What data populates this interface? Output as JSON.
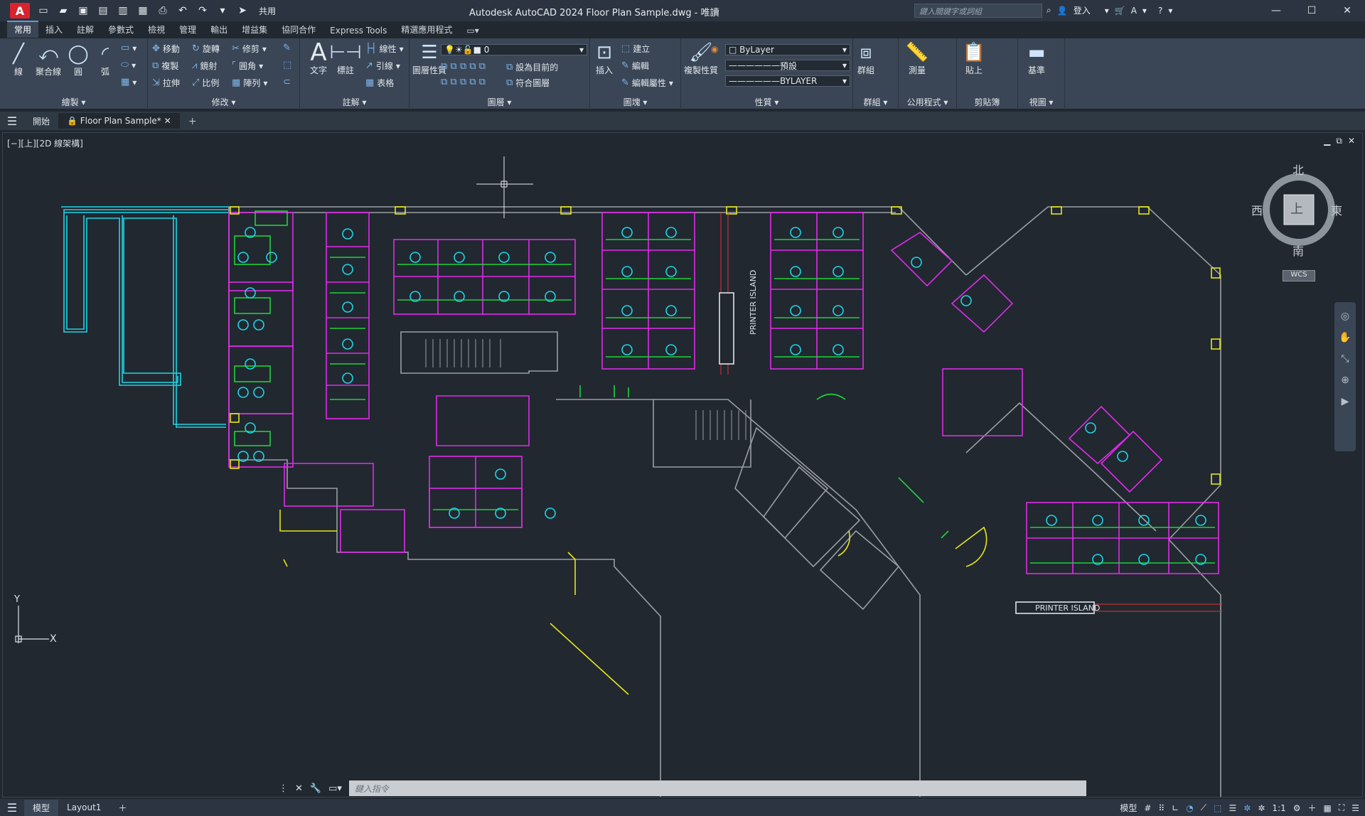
{
  "window": {
    "title": "Autodesk AutoCAD 2024    Floor Plan Sample.dwg - 唯讀",
    "search_placeholder": "鍵入關鍵字或詞組",
    "signin": "登入",
    "share": "共用"
  },
  "ribbon_tabs": [
    "常用",
    "插入",
    "註解",
    "參數式",
    "檢視",
    "管理",
    "輸出",
    "增益集",
    "協同合作",
    "Express Tools",
    "精選應用程式"
  ],
  "ribbon": {
    "draw": {
      "label": "繪製",
      "line": "線",
      "polyline": "聚合線",
      "circle": "圓",
      "arc": "弧"
    },
    "modify": {
      "label": "修改",
      "move": "移動",
      "rotate": "旋轉",
      "trim": "修剪",
      "copy": "複製",
      "mirror": "鏡射",
      "fillet": "圓角",
      "stretch": "拉伸",
      "scale": "比例",
      "array": "陣列"
    },
    "annotation": {
      "label": "註解",
      "text": "文字",
      "dimension": "標註",
      "linear": "線性",
      "leader": "引線",
      "table": "表格"
    },
    "layers": {
      "label": "圖層",
      "layer_props": "圖層性質",
      "current_layer": "0",
      "set_current": "設為目前的",
      "match_layer": "符合圖層"
    },
    "block": {
      "label": "圖塊",
      "insert": "插入",
      "create": "建立",
      "edit": "編輯",
      "edit_attr": "編輯屬性"
    },
    "properties": {
      "label": "性質",
      "match_props": "複製性質",
      "color": "ByLayer",
      "linetype": "預設",
      "lineweight": "BYLAYER"
    },
    "groups": {
      "label": "群組",
      "group": "群組"
    },
    "utilities": {
      "label": "公用程式",
      "measure": "測量"
    },
    "clipboard": {
      "label": "剪貼簿",
      "paste": "貼上"
    },
    "view": {
      "label": "視圖",
      "base": "基準"
    }
  },
  "doc_tabs": {
    "start": "開始",
    "active": "Floor Plan Sample*"
  },
  "viewport": {
    "label": "[−][上][2D 線架構]",
    "viewcube": {
      "north": "北",
      "south": "南",
      "east": "東",
      "west": "西",
      "face": "上",
      "wcs": "WCS"
    },
    "ucs": {
      "x": "X",
      "y": "Y"
    },
    "printer_island_1": "PRINTER ISLAND",
    "printer_island_2": "PRINTER  ISLAND"
  },
  "command": {
    "placeholder": "鍵入指令"
  },
  "status": {
    "model": "模型",
    "layout1": "Layout1",
    "model_btn": "模型",
    "scale": "1:1"
  },
  "colors": {
    "wall_cyan": "#1fd5e6",
    "magenta": "#e02be8",
    "green": "#21d13a",
    "yellow": "#e6e619",
    "red": "#e83030",
    "gray": "#9a9ea3",
    "blue": "#3b4cff"
  }
}
